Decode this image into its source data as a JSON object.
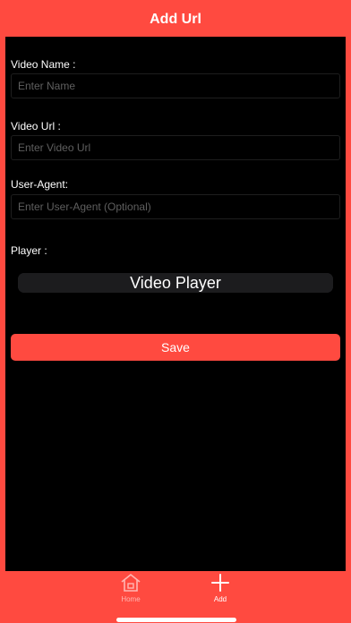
{
  "header": {
    "title": "Add Url"
  },
  "form": {
    "video_name": {
      "label": "Video Name :",
      "placeholder": "Enter Name"
    },
    "video_url": {
      "label": "Video Url :",
      "placeholder": "Enter Video Url"
    },
    "user_agent": {
      "label": "User-Agent:",
      "placeholder": "Enter User-Agent (Optional)"
    },
    "player": {
      "label": "Player :",
      "selected": "Video Player"
    },
    "save_label": "Save"
  },
  "tabbar": {
    "items": [
      {
        "label": "Home",
        "icon": "house-icon",
        "active": false
      },
      {
        "label": "Add",
        "icon": "plus-icon",
        "active": true
      }
    ]
  },
  "colors": {
    "accent": "#ff4a40",
    "panel": "#000000",
    "text": "#ffffff",
    "placeholder": "#5f5f5f"
  }
}
